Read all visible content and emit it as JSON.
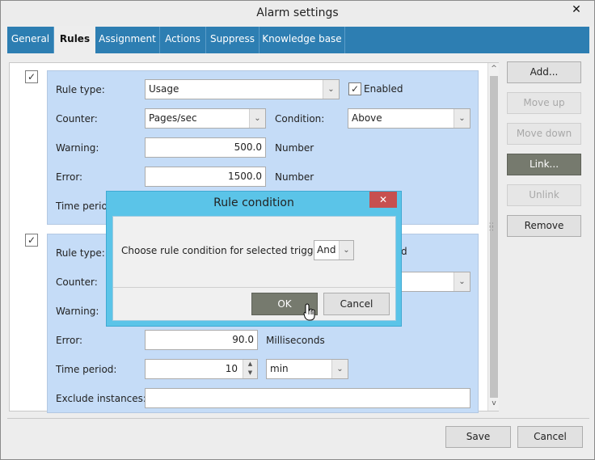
{
  "window": {
    "title": "Alarm settings",
    "close_glyph": "✕"
  },
  "tabs": [
    {
      "label": "General"
    },
    {
      "label": "Rules"
    },
    {
      "label": "Assignment"
    },
    {
      "label": "Actions"
    },
    {
      "label": "Suppress"
    },
    {
      "label": "Knowledge base"
    }
  ],
  "active_tab": "Rules",
  "rule1": {
    "checked": true,
    "rule_type_label": "Rule type:",
    "rule_type_value": "Usage",
    "enabled_label": "Enabled",
    "counter_label": "Counter:",
    "counter_value": "Pages/sec",
    "condition_label": "Condition:",
    "condition_value": "Above",
    "warning_label": "Warning:",
    "warning_value": "500.0",
    "warning_unit": "Number",
    "error_label": "Error:",
    "error_value": "1500.0",
    "error_unit": "Number",
    "time_period_label": "Time period:"
  },
  "rule2": {
    "checked": true,
    "rule_type_label": "Rule type:",
    "enabled_fragment": "d",
    "counter_label": "Counter:",
    "warning_label": "Warning:",
    "error_label": "Error:",
    "error_value": "90.0",
    "error_unit": "Milliseconds",
    "time_period_label": "Time period:",
    "time_period_value": "10",
    "time_period_unit": "min",
    "exclude_label": "Exclude instances:",
    "exclude_value": ""
  },
  "side_buttons": {
    "add": "Add...",
    "move_up": "Move up",
    "move_down": "Move down",
    "link": "Link...",
    "unlink": "Unlink",
    "remove": "Remove"
  },
  "footer": {
    "save": "Save",
    "cancel": "Cancel"
  },
  "dialog": {
    "title": "Rule condition",
    "close_glyph": "✕",
    "prompt": "Choose rule condition for selected triggers:",
    "condition_value": "And",
    "ok": "OK",
    "cancel": "Cancel"
  },
  "icons": {
    "check": "✓",
    "dropdown": "⌄",
    "scroll_up": "^",
    "scroll_down": "v"
  }
}
